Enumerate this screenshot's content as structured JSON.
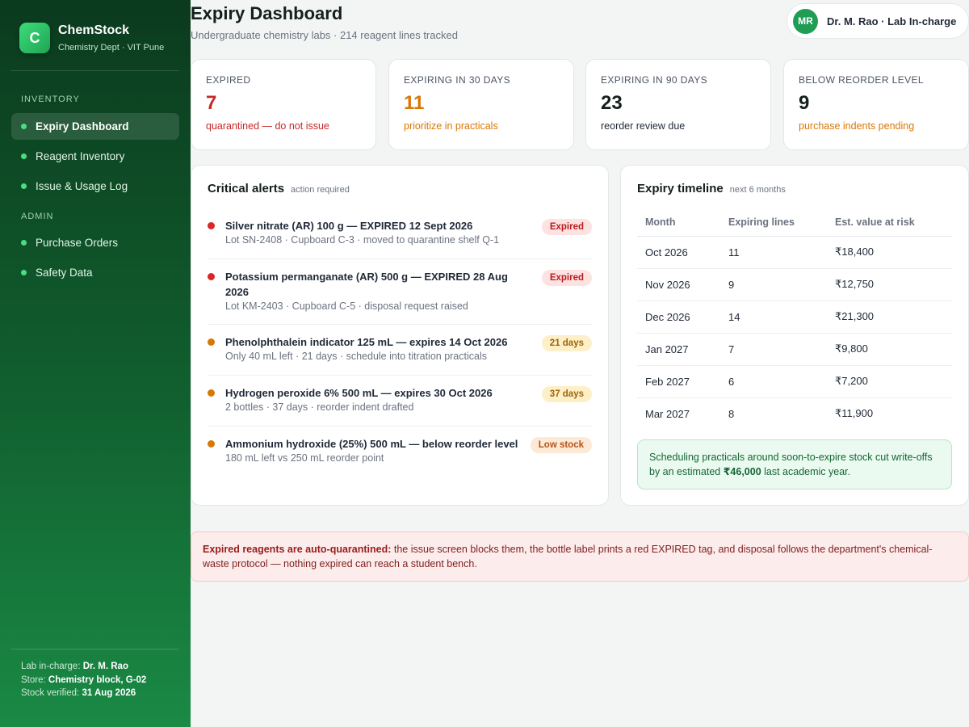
{
  "brand": {
    "logo_letter": "C",
    "name": "ChemStock",
    "subtitle": "Chemistry Dept · VIT Pune"
  },
  "sidebar": {
    "sections": [
      {
        "label": "INVENTORY",
        "items": [
          {
            "label": "Expiry Dashboard",
            "active": true
          },
          {
            "label": "Reagent Inventory",
            "active": false
          },
          {
            "label": "Issue & Usage Log",
            "active": false
          }
        ]
      },
      {
        "label": "ADMIN",
        "items": [
          {
            "label": "Purchase Orders",
            "active": false
          },
          {
            "label": "Safety Data",
            "active": false
          }
        ]
      }
    ],
    "footer": {
      "incharge_label": "Lab in-charge:",
      "incharge_value": "Dr. M. Rao",
      "store_label": "Store:",
      "store_value": "Chemistry block, G-02",
      "verified_label": "Stock verified:",
      "verified_value": "31 Aug 2026"
    }
  },
  "header": {
    "title": "Expiry Dashboard",
    "subtitle": "Undergraduate chemistry labs · 214 reagent lines tracked",
    "user_initials": "MR",
    "user_name": "Dr. M. Rao · Lab In-charge"
  },
  "stats": [
    {
      "label": "EXPIRED",
      "value": "7",
      "note": "quarantined — do not issue",
      "value_color": "#c62828",
      "note_color": "#c62828"
    },
    {
      "label": "EXPIRING IN 30 DAYS",
      "value": "11",
      "note": "prioritize in practicals",
      "value_color": "#d97706",
      "note_color": "#d97706"
    },
    {
      "label": "EXPIRING IN 90 DAYS",
      "value": "23",
      "note": "reorder review due",
      "value_color": "#14201a",
      "note_color": "#1f2937"
    },
    {
      "label": "BELOW REORDER LEVEL",
      "value": "9",
      "note": "purchase indents pending",
      "value_color": "#14201a",
      "note_color": "#d97706"
    }
  ],
  "alerts_panel": {
    "title": "Critical alerts",
    "subtitle": "action required",
    "items": [
      {
        "title": "Silver nitrate (AR) 100 g — EXPIRED 12 Sept 2026",
        "detail": "Lot SN-2408 · Cupboard C-3 · moved to quarantine shelf Q-1",
        "badge": "Expired",
        "dot_color": "#dc2626"
      },
      {
        "title": "Potassium permanganate (AR) 500 g — EXPIRED 28 Aug 2026",
        "detail": "Lot KM-2403 · Cupboard C-5 · disposal request raised",
        "badge": "Expired",
        "dot_color": "#dc2626"
      },
      {
        "title": "Phenolphthalein indicator 125 mL — expires 14 Oct 2026",
        "detail": "Only 40 mL left · 21 days · schedule into titration practicals",
        "badge": "21 days",
        "dot_color": "#d97706"
      },
      {
        "title": "Hydrogen peroxide 6% 500 mL — expires 30 Oct 2026",
        "detail": "2 bottles · 37 days · reorder indent drafted",
        "badge": "37 days",
        "dot_color": "#d97706"
      },
      {
        "title": "Ammonium hydroxide (25%) 500 mL — below reorder level",
        "detail": "180 mL left vs 250 mL reorder point",
        "badge": "Low stock",
        "dot_color": "#d97706"
      }
    ]
  },
  "timeline_panel": {
    "title": "Expiry timeline",
    "subtitle": "next 6 months",
    "columns": [
      "Month",
      "Expiring lines",
      "Est. value at risk"
    ],
    "rows": [
      [
        "Oct 2026",
        "11",
        "₹18,400"
      ],
      [
        "Nov 2026",
        "9",
        "₹12,750"
      ],
      [
        "Dec 2026",
        "14",
        "₹21,300"
      ],
      [
        "Jan 2027",
        "7",
        "₹9,800"
      ],
      [
        "Feb 2027",
        "6",
        "₹7,200"
      ],
      [
        "Mar 2027",
        "8",
        "₹11,900"
      ]
    ],
    "tip_before": "Scheduling practicals around soon-to-expire stock cut write-offs by an estimated ",
    "tip_amount": "₹46,000",
    "tip_after": " last academic year."
  },
  "banner": {
    "bold": "Expired reagents are auto-quarantined:",
    "text": " the issue screen blocks them, the bottle label prints a red EXPIRED tag, and disposal follows the department's chemical-waste protocol — nothing expired can reach a student bench."
  }
}
